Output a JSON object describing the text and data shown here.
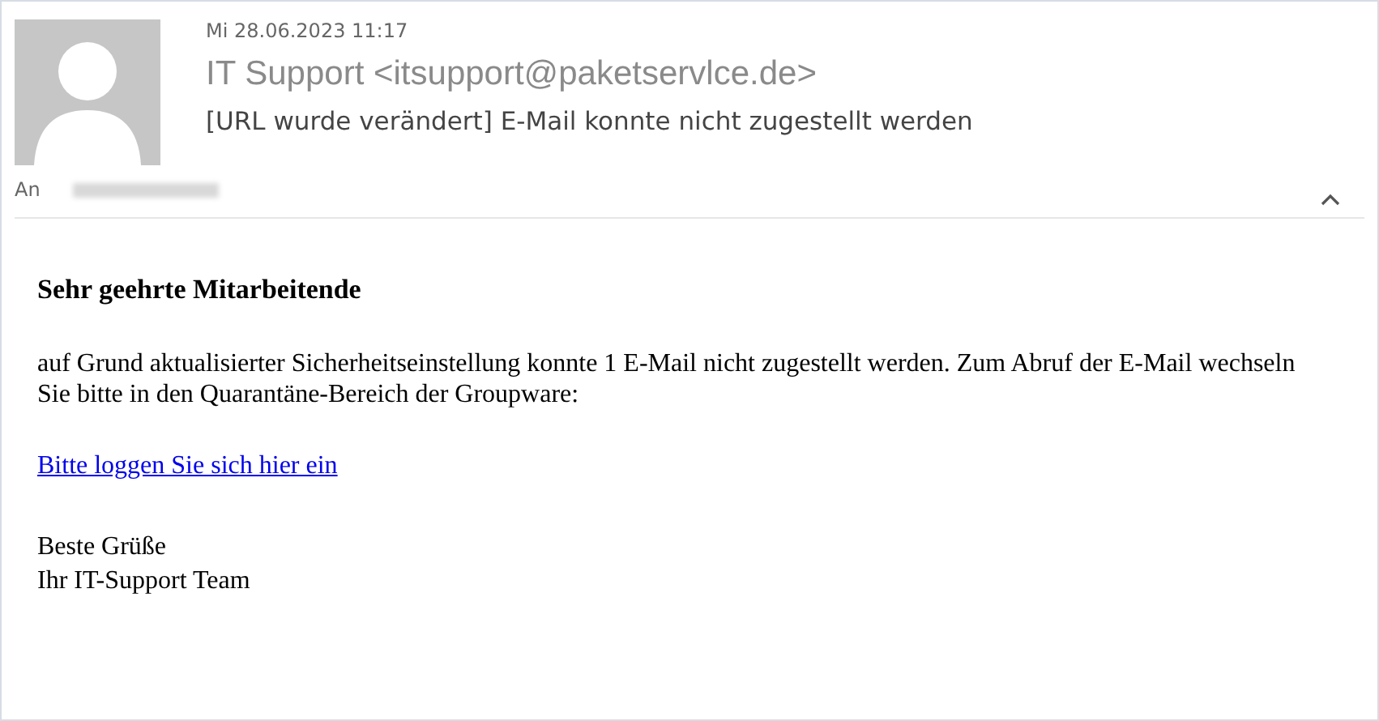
{
  "header": {
    "date": "Mi 28.06.2023 11:17",
    "sender": "IT Support <itsupport@paketservlce.de>",
    "subject": "[URL wurde verändert] E-Mail konnte nicht zugestellt werden",
    "to_label": "An",
    "expanded": true
  },
  "body": {
    "greeting": "Sehr geehrte Mitarbeitende",
    "paragraph": "auf Grund aktualisierter Sicherheitseinstellung konnte 1 E-Mail nicht zugestellt werden. Zum Abruf der E-Mail wechseln Sie bitte in den Quarantäne-Bereich der Groupware:",
    "link": "Bitte loggen Sie sich hier ein",
    "closing": [
      "Beste Grüße",
      "Ihr IT-Support Team"
    ]
  }
}
